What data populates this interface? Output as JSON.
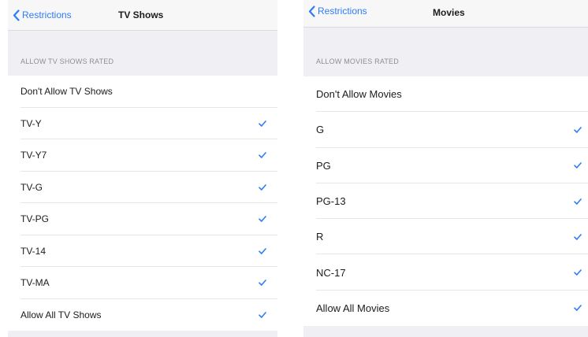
{
  "accent_color": "#2f7cf6",
  "tv": {
    "back_label": "Restrictions",
    "title": "TV Shows",
    "section_header": "ALLOW TV SHOWS RATED",
    "rows": [
      {
        "label": "Don't Allow TV Shows",
        "checked": false
      },
      {
        "label": "TV-Y",
        "checked": true
      },
      {
        "label": "TV-Y7",
        "checked": true
      },
      {
        "label": "TV-G",
        "checked": true
      },
      {
        "label": "TV-PG",
        "checked": true
      },
      {
        "label": "TV-14",
        "checked": true
      },
      {
        "label": "TV-MA",
        "checked": true
      },
      {
        "label": "Allow All TV Shows",
        "checked": true
      }
    ]
  },
  "movies": {
    "back_label": "Restrictions",
    "title": "Movies",
    "section_header": "ALLOW MOVIES RATED",
    "rows": [
      {
        "label": "Don't Allow Movies",
        "checked": false
      },
      {
        "label": "G",
        "checked": true
      },
      {
        "label": "PG",
        "checked": true
      },
      {
        "label": "PG-13",
        "checked": true
      },
      {
        "label": "R",
        "checked": true
      },
      {
        "label": "NC-17",
        "checked": true
      },
      {
        "label": "Allow All Movies",
        "checked": true
      }
    ]
  }
}
